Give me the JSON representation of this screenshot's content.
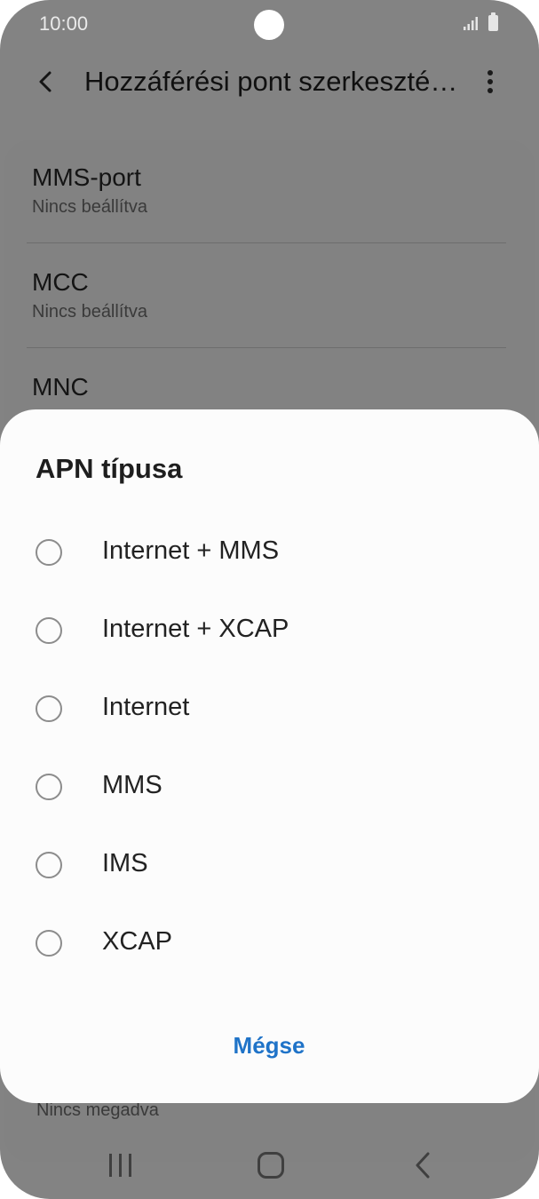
{
  "status_bar": {
    "time": "10:00",
    "icons": [
      "camera-cutout",
      "signal-icon",
      "battery-icon"
    ]
  },
  "header": {
    "back_icon": "chevron-left-icon",
    "title": "Hozzáférési pont szerkeszté…",
    "more_icon": "more-vertical-icon"
  },
  "settings": {
    "items": [
      {
        "title": "MMS-port",
        "subtitle": "Nincs beállítva"
      },
      {
        "title": "MCC",
        "subtitle": "Nincs beállítva"
      },
      {
        "title": "MNC",
        "subtitle": ""
      }
    ],
    "peek_text": "Nincs megadva"
  },
  "dialog": {
    "title": "APN típusa",
    "options": [
      {
        "label": "Internet + MMS",
        "selected": false
      },
      {
        "label": "Internet + XCAP",
        "selected": false
      },
      {
        "label": "Internet",
        "selected": false
      },
      {
        "label": "MMS",
        "selected": false
      },
      {
        "label": "IMS",
        "selected": false
      },
      {
        "label": "XCAP",
        "selected": false
      }
    ],
    "cancel_label": "Mégse",
    "accent_color": "#1f73c8"
  },
  "nav_bar": {
    "icons": [
      "recents-icon",
      "home-icon",
      "back-icon"
    ]
  }
}
